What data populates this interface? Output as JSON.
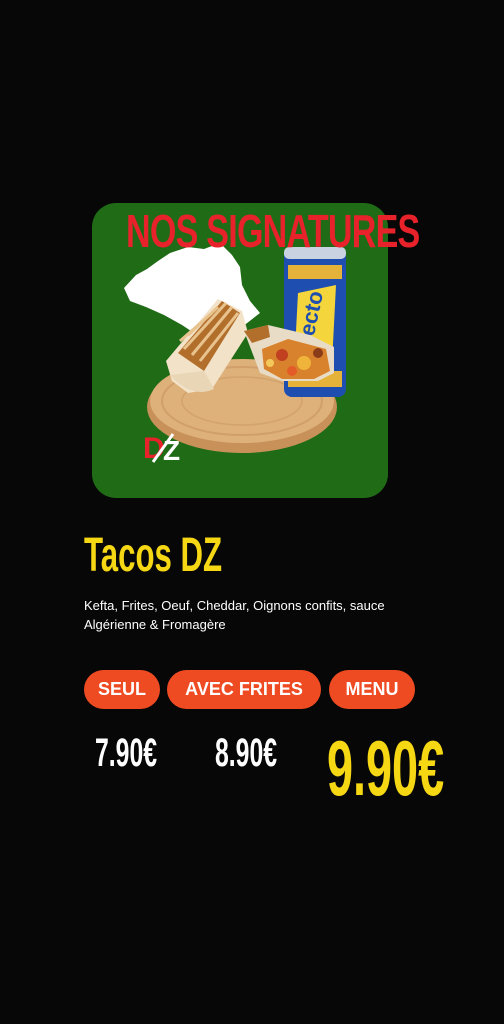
{
  "banner": {
    "title": "NOS SIGNATURES"
  },
  "hero": {
    "logo_text": "DZ",
    "can_label": "Selecto",
    "background_color": "#1f6b16"
  },
  "product": {
    "name": "Tacos DZ",
    "description": "Kefta, Frites, Oeuf, Cheddar, Oignons confits, sauce Algérienne & Fromagère"
  },
  "options": [
    {
      "label": "SEUL",
      "price": "7.90€"
    },
    {
      "label": "AVEC FRITES",
      "price": "8.90€"
    },
    {
      "label": "MENU",
      "price": "9.90€"
    }
  ],
  "colors": {
    "background": "#070707",
    "title_red": "#e8222a",
    "accent_yellow": "#f5d714",
    "pill_orange": "#ef4b23"
  }
}
